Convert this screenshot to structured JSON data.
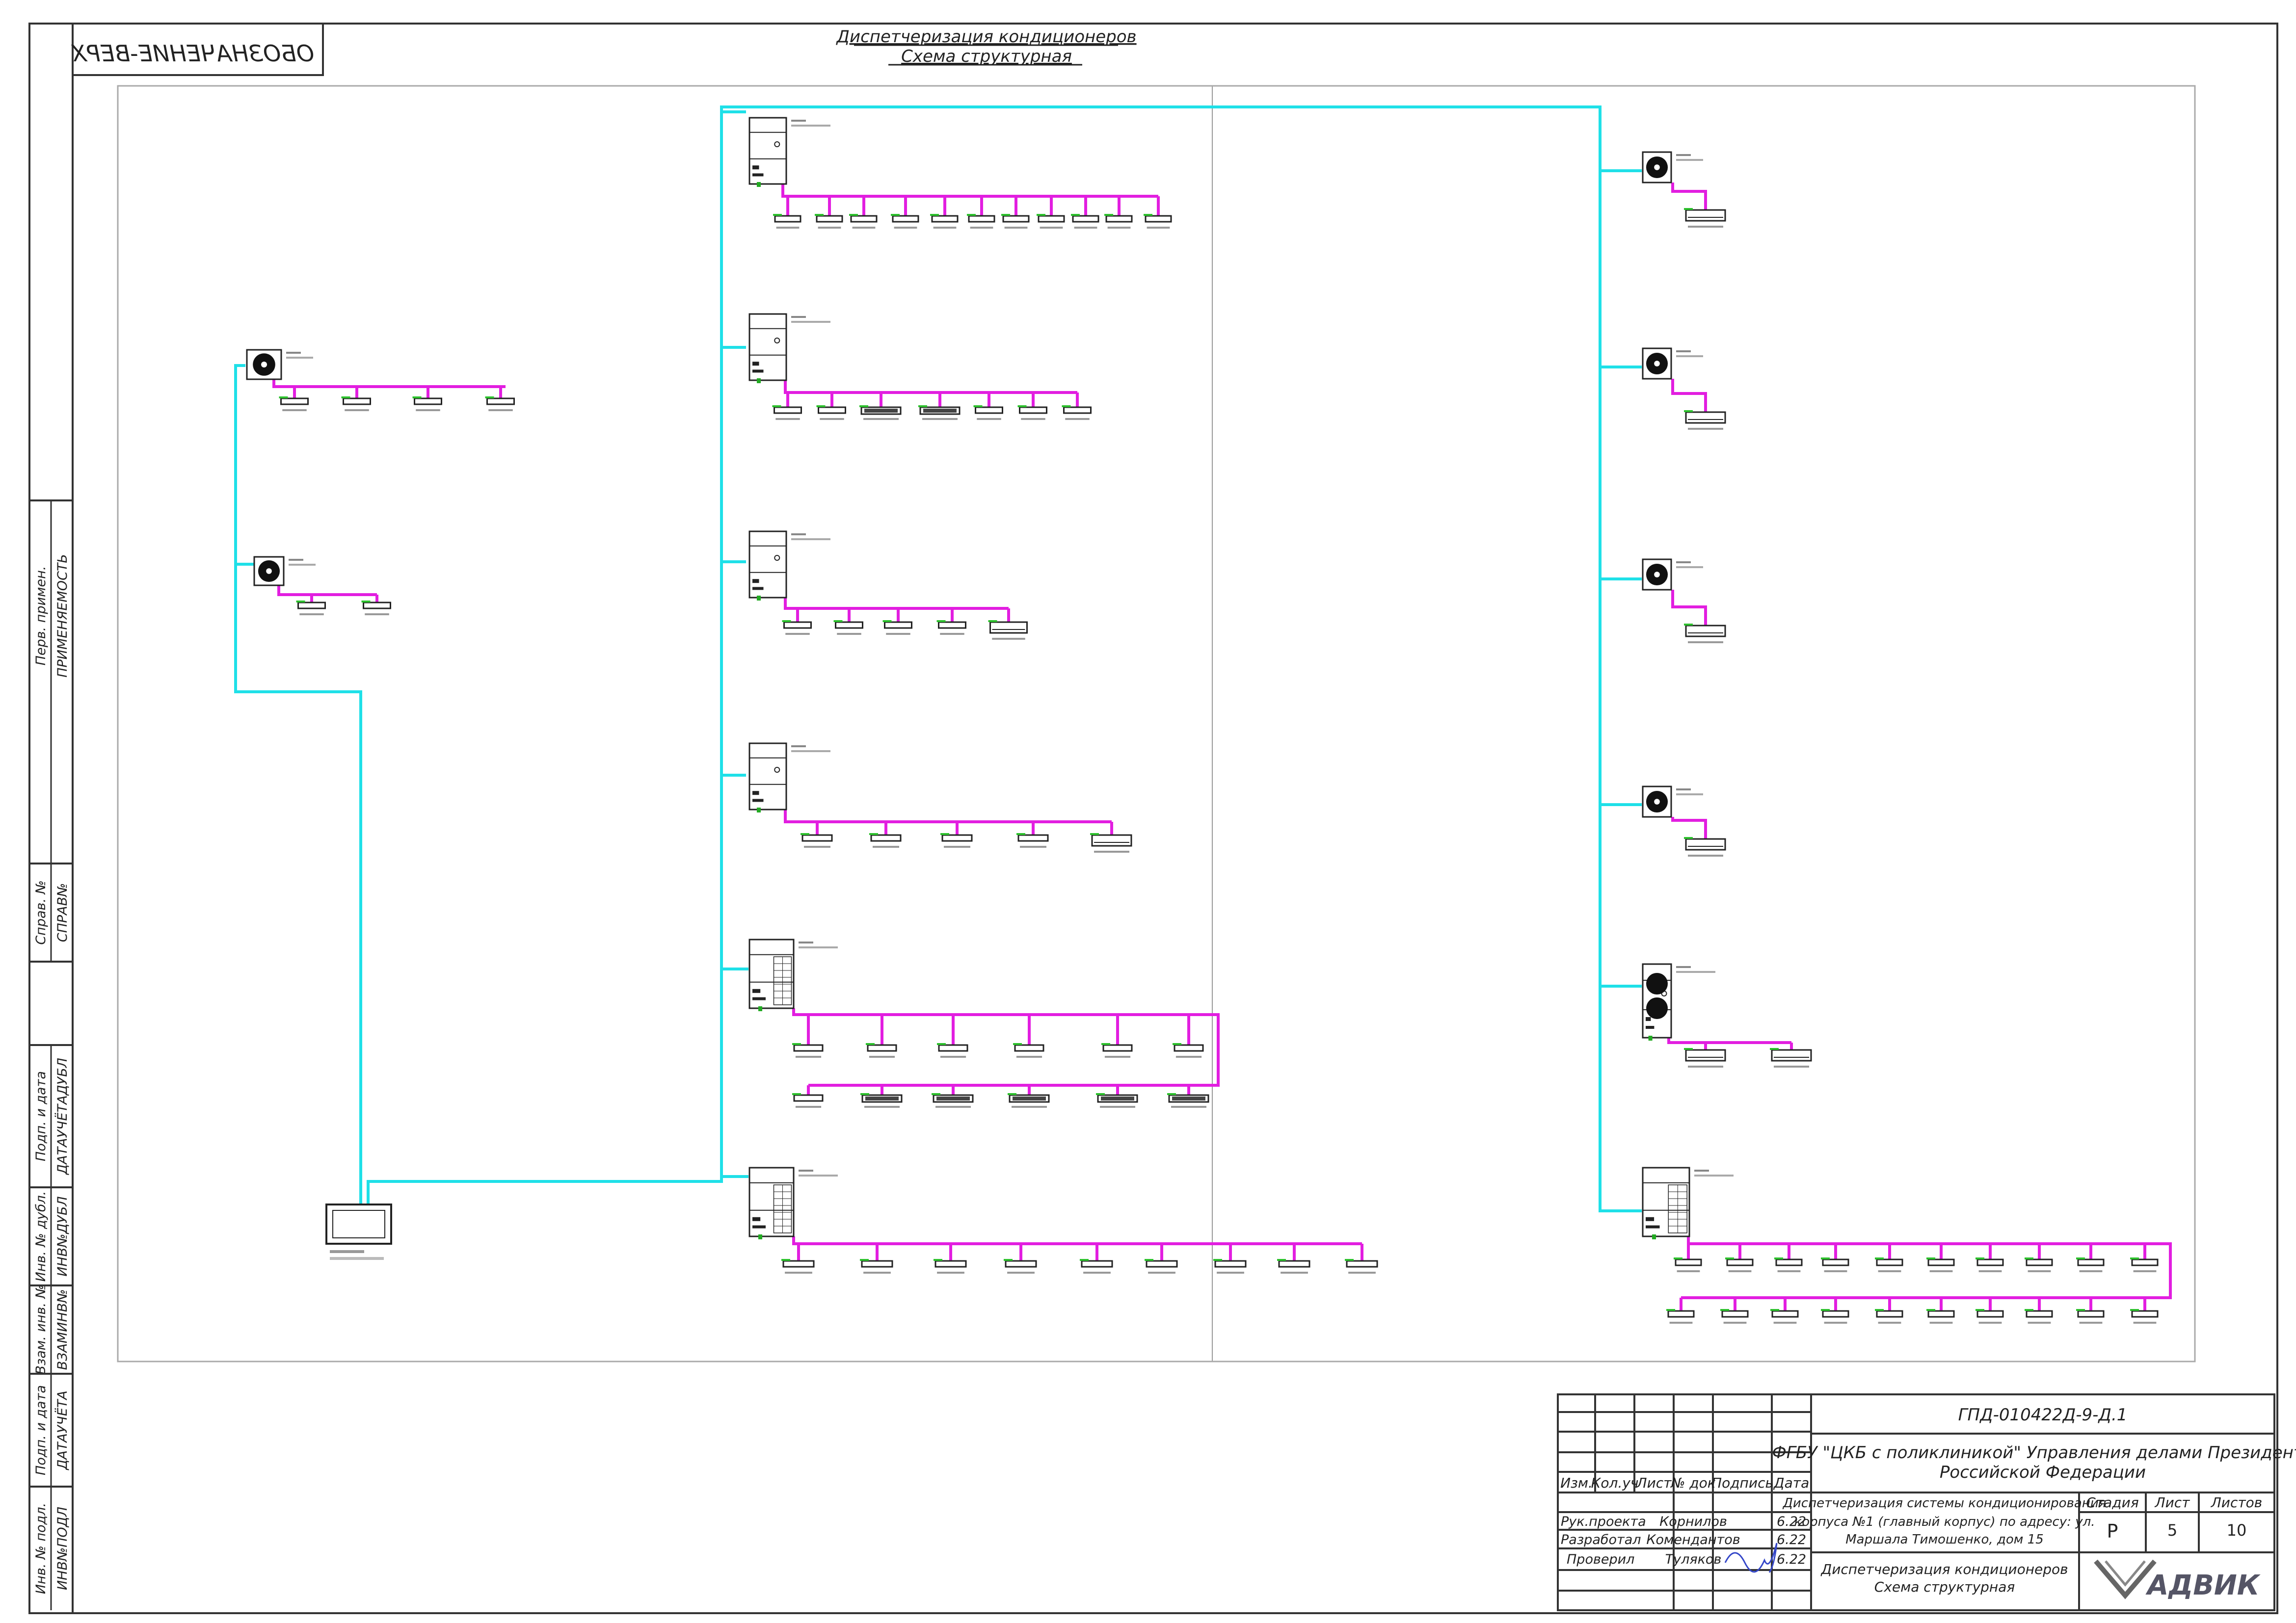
{
  "sheet": {
    "title_line1": "Диспетчеризация кондиционеров",
    "title_line2": "Схема структурная",
    "mirrored_stamp": "ОБОЗНАЧЕНИЕ-ВЕРХ"
  },
  "side_stamp": {
    "rows": [
      {
        "label": "Перв. примен.",
        "value": "ПРИМЕНЯЕМОСТЬ"
      },
      {
        "label": "Справ. №",
        "value": "СПРАВ№"
      },
      {
        "label": "Подп. и дата",
        "value": "ДАТАУЧЁТАДУБЛ"
      },
      {
        "label": "Инв. № дубл.",
        "value": "ИНВ№ДУБЛ"
      },
      {
        "label": "Взам. инв. №",
        "value": "ВЗАМИНВ№"
      },
      {
        "label": "Подп. и дата",
        "value": "ДАТАУЧЁТА"
      },
      {
        "label": "Инв. № подл.",
        "value": "ИНВ№ПОДЛ"
      }
    ]
  },
  "title_block": {
    "code": "ГПД-010422Д-9-Д.1",
    "organization": [
      "ФГБУ \"ЦКБ с поликлиникой\" Управления делами Президента",
      "Российской Федерации"
    ],
    "headers": {
      "izm": "Изм.",
      "koluch": "Кол.уч",
      "list": "Лист",
      "ndok": "№ док",
      "podpis": "Подпись",
      "data": "Дата"
    },
    "roles": [
      {
        "role": "Рук.проекта",
        "name": "Корнилов",
        "date": "6.22"
      },
      {
        "role": "Разработал",
        "name": "Комендантов",
        "date": "6.22"
      },
      {
        "role": "Проверил",
        "name": "Туляков",
        "date": "6.22"
      }
    ],
    "project": [
      "Диспетчеризация системы кондиционирования",
      "корпуса №1 (главный корпус) по адресу: ул.",
      "Маршала Тимошенко, дом 15"
    ],
    "stage_label": "Стадия",
    "sheet_label": "Лист",
    "sheets_label": "Листов",
    "stage": "Р",
    "sheet_no": "5",
    "sheets_total": "10",
    "drawing_name": [
      "Диспетчеризация кондиционеров",
      "Схема структурная"
    ],
    "logo_text": "АДВИК"
  },
  "legend_colors": {
    "control_bus": "#1fe0e8",
    "refrigerant_bus": "#e21ee0",
    "line": "#222222"
  }
}
